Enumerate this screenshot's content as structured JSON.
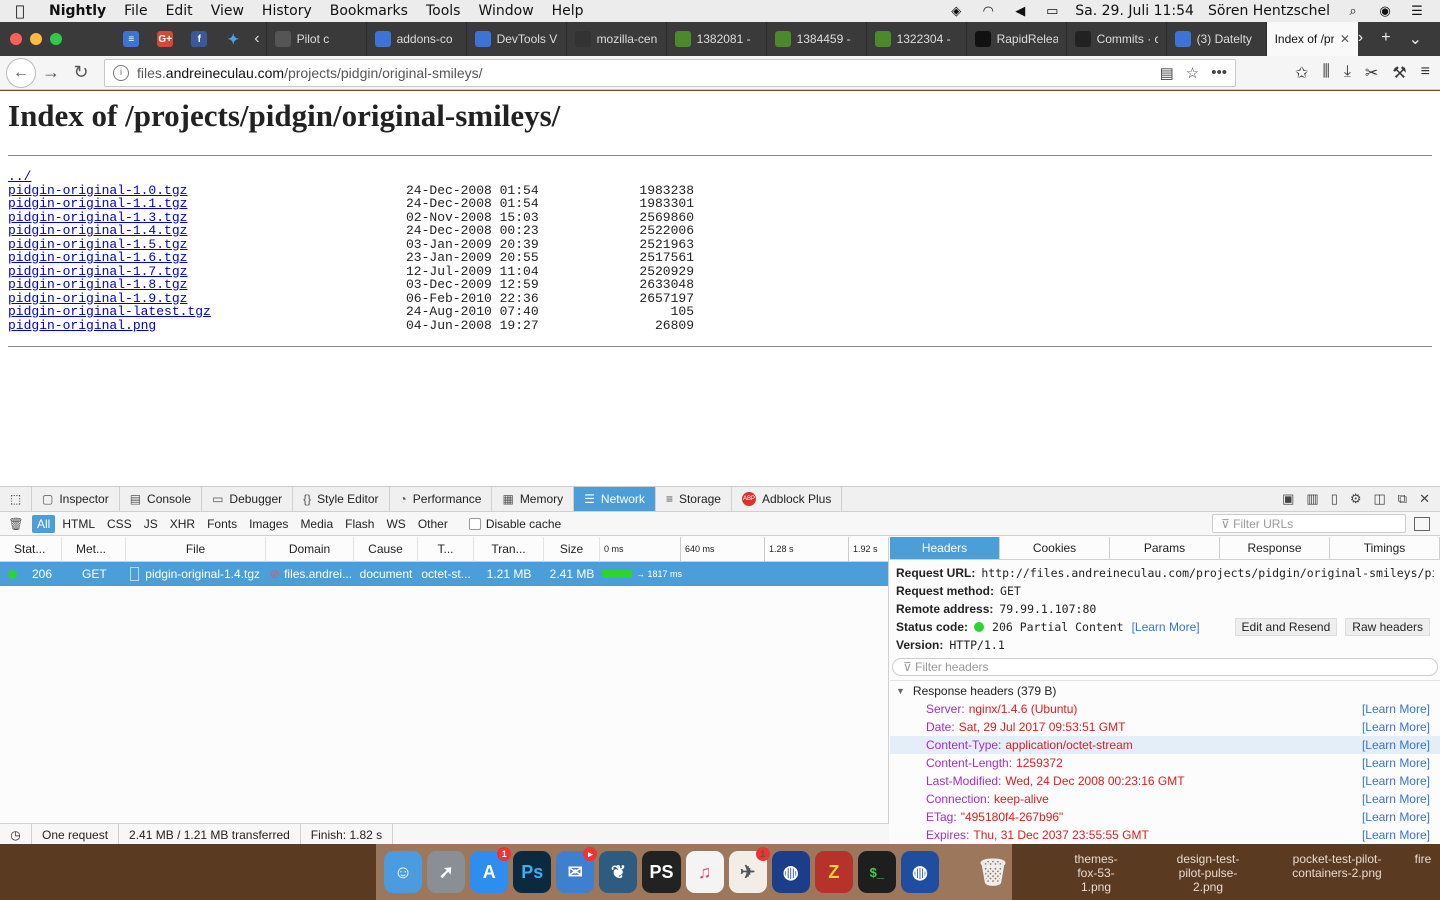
{
  "menubar": {
    "app": "Nightly",
    "items": [
      "File",
      "Edit",
      "View",
      "History",
      "Bookmarks",
      "Tools",
      "Window",
      "Help"
    ],
    "clock": "Sa. 29. Juli  11:54",
    "user": "Sören Hentzschel"
  },
  "tabs": [
    {
      "label": "Pilot c",
      "color": "#555"
    },
    {
      "label": "addons-co",
      "color": "#3b73d6"
    },
    {
      "label": "DevTools V",
      "color": "#3b73d6"
    },
    {
      "label": "mozilla-cen",
      "color": "#333"
    },
    {
      "label": "1382081 -",
      "color": "#4a8a2a"
    },
    {
      "label": "1384459 -",
      "color": "#4a8a2a"
    },
    {
      "label": "1322304 -",
      "color": "#4a8a2a"
    },
    {
      "label": "RapidRelea",
      "color": "#111"
    },
    {
      "label": "Commits · c",
      "color": "#222"
    },
    {
      "label": "(3) Datelty",
      "color": "#3b73d6"
    }
  ],
  "active_tab": "Index of /pro",
  "url": {
    "prefix": "files.",
    "host": "andreineculau.com",
    "path": "/projects/pidgin/original-smileys/"
  },
  "page": {
    "title": "Index of /projects/pidgin/original-smileys/",
    "parent": "../",
    "files": [
      {
        "name": "pidgin-original-1.0.tgz",
        "date": "24-Dec-2008 01:54",
        "size": "1983238"
      },
      {
        "name": "pidgin-original-1.1.tgz",
        "date": "24-Dec-2008 01:54",
        "size": "1983301"
      },
      {
        "name": "pidgin-original-1.3.tgz",
        "date": "02-Nov-2008 15:03",
        "size": "2569860"
      },
      {
        "name": "pidgin-original-1.4.tgz",
        "date": "24-Dec-2008 00:23",
        "size": "2522006"
      },
      {
        "name": "pidgin-original-1.5.tgz",
        "date": "03-Jan-2009 20:39",
        "size": "2521963"
      },
      {
        "name": "pidgin-original-1.6.tgz",
        "date": "23-Jan-2009 20:55",
        "size": "2517561"
      },
      {
        "name": "pidgin-original-1.7.tgz",
        "date": "12-Jul-2009 11:04",
        "size": "2520929"
      },
      {
        "name": "pidgin-original-1.8.tgz",
        "date": "03-Dec-2009 12:59",
        "size": "2633048"
      },
      {
        "name": "pidgin-original-1.9.tgz",
        "date": "06-Feb-2010 22:36",
        "size": "2657197"
      },
      {
        "name": "pidgin-original-latest.tgz",
        "date": "24-Aug-2010 07:40",
        "size": "105"
      },
      {
        "name": "pidgin-original.png",
        "date": "04-Jun-2008 19:27",
        "size": "26809"
      }
    ]
  },
  "devtools": {
    "tabs": [
      {
        "label": "Inspector",
        "icon": "▢"
      },
      {
        "label": "Console",
        "icon": "▤"
      },
      {
        "label": "Debugger",
        "icon": "▭"
      },
      {
        "label": "Style Editor",
        "icon": "{}"
      },
      {
        "label": "Performance",
        "icon": "◔"
      },
      {
        "label": "Memory",
        "icon": "▦"
      },
      {
        "label": "Network",
        "icon": "☰",
        "active": true
      },
      {
        "label": "Storage",
        "icon": "≡"
      },
      {
        "label": "Adblock Plus",
        "icon": "ABP"
      }
    ],
    "filters": [
      "All",
      "HTML",
      "CSS",
      "JS",
      "XHR",
      "Fonts",
      "Images",
      "Media",
      "Flash",
      "WS",
      "Other"
    ],
    "disable_cache": "Disable cache",
    "filter_urls_placeholder": "Filter URLs",
    "columns": {
      "status": "Stat...",
      "method": "Met...",
      "file": "File",
      "domain": "Domain",
      "cause": "Cause",
      "type": "T...",
      "transferred": "Tran...",
      "size": "Size"
    },
    "waterfall_ticks": [
      "0 ms",
      "640 ms",
      "1.28 s",
      "1.92 s"
    ],
    "request": {
      "status": "206",
      "method": "GET",
      "file": "pidgin-original-1.4.tgz",
      "domain": "files.andrei...",
      "cause": "document",
      "type": "octet-st...",
      "transferred": "1.21 MB",
      "size": "2.41 MB",
      "timing": "→ 1817 ms"
    },
    "statusbar": {
      "requests": "One request",
      "transferred": "2.41 MB / 1.21 MB transferred",
      "finish": "Finish: 1.82 s"
    },
    "side_tabs": [
      "Headers",
      "Cookies",
      "Params",
      "Response",
      "Timings"
    ],
    "summary": {
      "request_url_label": "Request URL:",
      "request_url": "http://files.andreineculau.com/projects/pidgin/original-smileys/pidg …",
      "method_label": "Request method:",
      "method": "GET",
      "remote_label": "Remote address:",
      "remote": "79.99.1.107:80",
      "status_label": "Status code:",
      "status": "206 Partial Content",
      "learn_more": "[Learn More]",
      "edit_resend": "Edit and Resend",
      "raw_headers": "Raw headers",
      "version_label": "Version:",
      "version": "HTTP/1.1"
    },
    "filter_headers_placeholder": "Filter headers",
    "response_headers_title": "Response headers (379 B)",
    "response_headers": [
      {
        "k": "Server:",
        "v": "nginx/1.4.6 (Ubuntu)"
      },
      {
        "k": "Date:",
        "v": "Sat, 29 Jul 2017 09:53:51 GMT"
      },
      {
        "k": "Content-Type:",
        "v": "application/octet-stream"
      },
      {
        "k": "Content-Length:",
        "v": "1259372"
      },
      {
        "k": "Last-Modified:",
        "v": "Wed, 24 Dec 2008 00:23:16 GMT"
      },
      {
        "k": "Connection:",
        "v": "keep-alive"
      },
      {
        "k": "ETag:",
        "v": "\"495180f4-267b96\""
      },
      {
        "k": "Expires:",
        "v": "Thu, 31 Dec 2037 23:55:55 GMT"
      }
    ],
    "header_learn_more": "[Learn More]"
  },
  "dock": {
    "apps": [
      "finder",
      "launchpad",
      "app-store",
      "photoshop",
      "mail",
      "sourcetree",
      "phpstorm",
      "itunes",
      "pilot",
      "firefox-nightly",
      "filezilla",
      "terminal",
      "firefox",
      "trash"
    ],
    "desktop_files": [
      "themes-fox-53-1.png",
      "design-test-pilot-pulse-2.png",
      "pocket-test-pilot-containers-2.png",
      "fire"
    ]
  }
}
